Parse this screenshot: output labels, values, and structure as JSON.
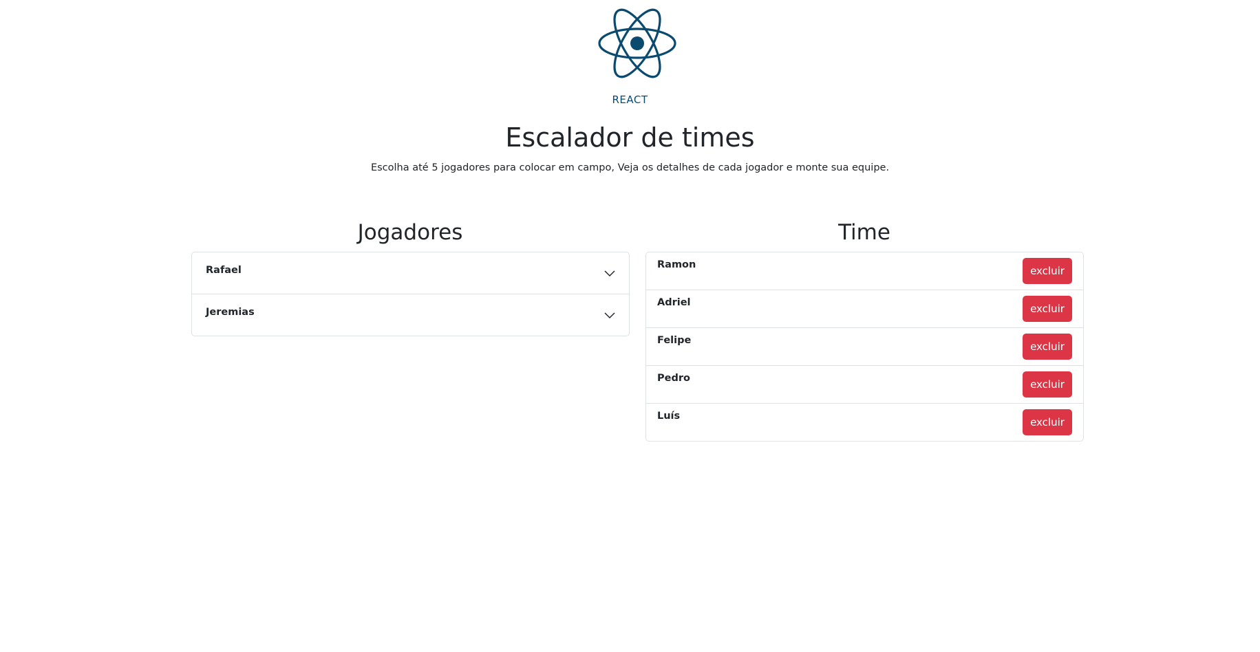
{
  "logo": {
    "label": "REACT",
    "color": "#0b4a6f"
  },
  "header": {
    "title": "Escalador de times",
    "subtitle": "Escolha até 5 jogadores para colocar em campo, Veja os detalhes de cada jogador e monte sua equipe."
  },
  "players": {
    "heading": "Jogadores",
    "items": [
      {
        "name": "Rafael"
      },
      {
        "name": "Jeremias"
      }
    ]
  },
  "team": {
    "heading": "Time",
    "remove_label": "excluir",
    "items": [
      {
        "name": "Ramon"
      },
      {
        "name": "Adriel"
      },
      {
        "name": "Felipe"
      },
      {
        "name": "Pedro"
      },
      {
        "name": "Luís"
      }
    ]
  },
  "colors": {
    "danger": "#dc3545",
    "border": "#dee2e6"
  }
}
